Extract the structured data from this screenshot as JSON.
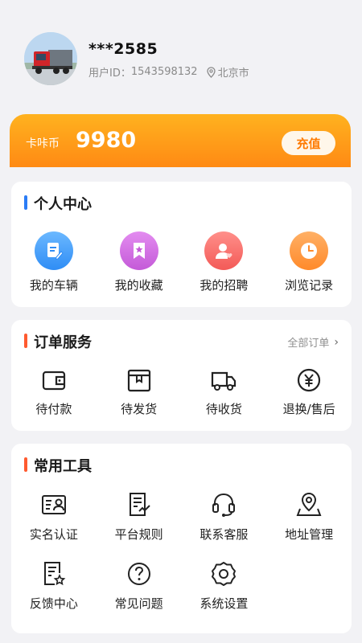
{
  "user": {
    "name": "***2585",
    "id_label": "用户ID：",
    "id_value": "1543598132",
    "city": "北京市",
    "avatar_icon": "truck-avatar"
  },
  "wallet": {
    "label": "卡咔币",
    "value": "9980",
    "recharge_label": "充值"
  },
  "personal": {
    "title": "个人中心",
    "accent": "#2b7cf6",
    "items": [
      {
        "label": "我的车辆",
        "icon": "document-edit-icon",
        "color": "#2f8df5"
      },
      {
        "label": "我的收藏",
        "icon": "bookmark-star-icon",
        "color": "#c45ad8"
      },
      {
        "label": "我的招聘",
        "icon": "person-heart-icon",
        "color": "#f35a57"
      },
      {
        "label": "浏览记录",
        "icon": "clock-icon",
        "color": "#ff8a2a"
      }
    ]
  },
  "orders": {
    "title": "订单服务",
    "accent": "#ff5a2f",
    "more_label": "全部订单",
    "items": [
      {
        "label": "待付款",
        "icon": "wallet-icon"
      },
      {
        "label": "待发货",
        "icon": "package-icon"
      },
      {
        "label": "待收货",
        "icon": "truck-icon"
      },
      {
        "label": "退换/售后",
        "icon": "yen-refund-icon"
      }
    ]
  },
  "tools": {
    "title": "常用工具",
    "accent": "#ff5a2f",
    "items": [
      {
        "label": "实名认证",
        "icon": "id-card-icon"
      },
      {
        "label": "平台规则",
        "icon": "rules-doc-icon"
      },
      {
        "label": "联系客服",
        "icon": "headset-icon"
      },
      {
        "label": "地址管理",
        "icon": "location-pin-icon"
      },
      {
        "label": "反馈中心",
        "icon": "feedback-doc-icon"
      },
      {
        "label": "常见问题",
        "icon": "question-icon"
      },
      {
        "label": "系统设置",
        "icon": "settings-gear-icon"
      }
    ]
  }
}
